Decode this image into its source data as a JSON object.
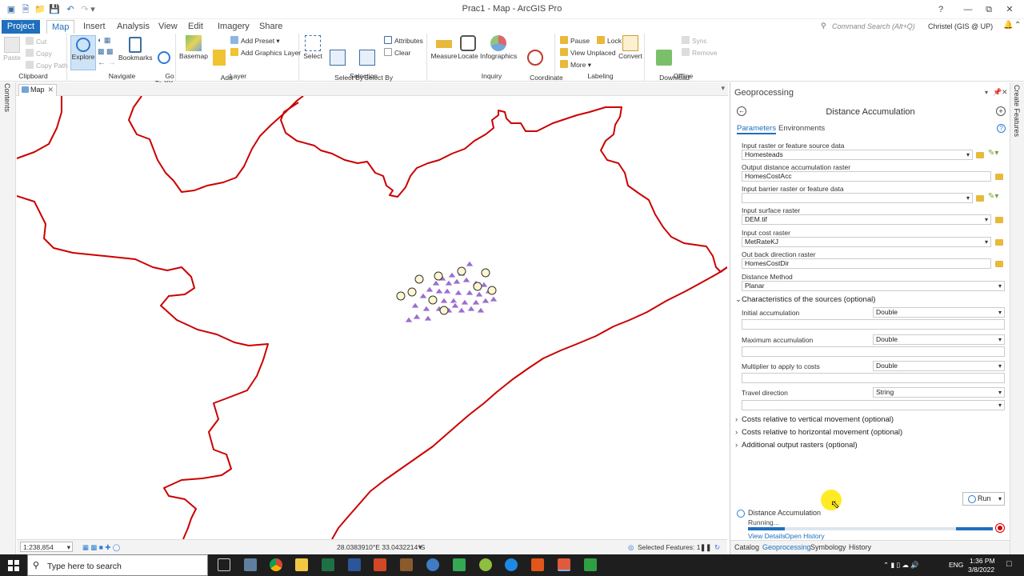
{
  "window": {
    "title": "Prac1 - Map - ArcGIS Pro",
    "help": "?"
  },
  "tabs": [
    {
      "label": "Project"
    },
    {
      "label": "Map"
    },
    {
      "label": "Insert"
    },
    {
      "label": "Analysis"
    },
    {
      "label": "View"
    },
    {
      "label": "Edit"
    },
    {
      "label": "Imagery"
    },
    {
      "label": "Share"
    }
  ],
  "command_search": {
    "placeholder": "Command Search (Alt+Q)"
  },
  "user": "Christel (GIS @ UP)",
  "ribbon": {
    "clipboard": {
      "label": "Clipboard",
      "paste": "Paste",
      "cut": "Cut",
      "copy": "Copy",
      "copy_path": "Copy Path"
    },
    "navigate": {
      "label": "Navigate",
      "explore": "Explore",
      "bookmarks": "Bookmarks",
      "go_to_xy": "Go\nTo XY"
    },
    "layer": {
      "label": "Layer",
      "basemap": "Basemap",
      "add_data": "Add\nData",
      "add_preset": "Add Preset",
      "add_graphics_layer": "Add Graphics Layer"
    },
    "selection": {
      "label": "Selection",
      "select": "Select",
      "select_by_attributes": "Select By\nAttributes",
      "select_by_location": "Select By\nLocation",
      "attributes": "Attributes",
      "clear": "Clear"
    },
    "inquiry": {
      "label": "Inquiry",
      "measure": "Measure",
      "locate": "Locate",
      "infographics": "Infographics",
      "coordinate_conversion": "Coordinate\nConversion"
    },
    "labeling": {
      "label": "Labeling",
      "pause": "Pause",
      "lock": "Lock",
      "view_unplaced": "View Unplaced",
      "more": "More",
      "convert": "Convert"
    },
    "offline": {
      "label": "Offline",
      "download_map": "Download\nMap",
      "sync": "Sync",
      "remove": "Remove"
    }
  },
  "left_pane": {
    "label": "Contents"
  },
  "right_pane": {
    "label": "Create Features"
  },
  "map": {
    "tab_label": "Map"
  },
  "map_status": {
    "scale": "1:238,854",
    "coords": "28.0383910°E 33.0432214°S",
    "selected": "Selected Features: 1"
  },
  "geoprocessing": {
    "header": "Geoprocessing",
    "tool": "Distance Accumulation",
    "tab_parameters": "Parameters",
    "tab_environments": "Environments",
    "params": [
      {
        "label": "Input raster or feature source data",
        "value": "Homesteads"
      },
      {
        "label": "Output distance accumulation raster",
        "value": "HomesCostAcc"
      },
      {
        "label": "Input barrier raster or feature data",
        "value": ""
      },
      {
        "label": "Input surface raster",
        "value": "DEM.tif"
      },
      {
        "label": "Input cost raster",
        "value": "MetRateKJ"
      },
      {
        "label": "Out back direction raster",
        "value": "HomesCostDir"
      },
      {
        "label": "Distance Method",
        "value": "Planar"
      }
    ],
    "characteristics": {
      "title": "Characteristics of the sources (optional)",
      "rows": [
        {
          "label": "Initial accumulation",
          "type": "Double"
        },
        {
          "label": "Maximum accumulation",
          "type": "Double"
        },
        {
          "label": "Multiplier to apply to costs",
          "type": "Double"
        },
        {
          "label": "Travel direction",
          "type": "String"
        }
      ]
    },
    "collapsed_sections": [
      "Costs relative to vertical movement (optional)",
      "Costs relative to horizontal movement (optional)",
      "Additional output rasters (optional)"
    ],
    "run_label": "Run",
    "status": {
      "tool": "Distance Accumulation",
      "state": "Running...",
      "view_details": "View Details",
      "open_history": "Open History",
      "progress": 0.15
    },
    "bottom_tabs": [
      "Catalog",
      "Geoprocessing",
      "Symbology",
      "History"
    ]
  },
  "taskbar": {
    "search_placeholder": "Type here to search",
    "language": "ENG",
    "time": "1:36 PM",
    "date": "3/8/2022"
  },
  "colors": {
    "accent": "#1f6fbd",
    "boundary": "#cc0000",
    "points": "#9b6fd0"
  }
}
